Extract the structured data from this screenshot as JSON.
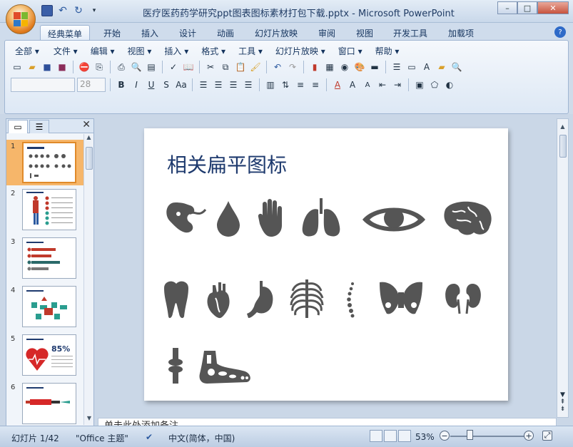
{
  "window": {
    "title": "医疗医药药学研究ppt图表图标素材打包下载.pptx - Microsoft PowerPoint",
    "controls": {
      "minimize": "–",
      "maximize": "□",
      "close": "✕"
    }
  },
  "ribbon_tabs": [
    "经典菜单",
    "开始",
    "插入",
    "设计",
    "动画",
    "幻灯片放映",
    "审阅",
    "视图",
    "开发工具",
    "加载项"
  ],
  "active_tab": "经典菜单",
  "classic_menu": [
    "全部 ▾",
    "文件 ▾",
    "编辑 ▾",
    "视图 ▾",
    "插入 ▾",
    "格式 ▾",
    "工具 ▾",
    "幻灯片放映 ▾",
    "窗口 ▾",
    "帮助 ▾"
  ],
  "format_bar": {
    "font_name": "",
    "font_size": "28",
    "bold": "B",
    "italic": "I",
    "underline": "U",
    "strike": "S",
    "case": "Aa"
  },
  "panel": {
    "close": "✕",
    "slides": [
      {
        "num": "1",
        "selected": true
      },
      {
        "num": "2",
        "selected": false
      },
      {
        "num": "3",
        "selected": false
      },
      {
        "num": "4",
        "selected": false
      },
      {
        "num": "5",
        "selected": false
      },
      {
        "num": "6",
        "selected": false
      }
    ],
    "slide5_percent": "85%"
  },
  "slide": {
    "title": "相关扁平图标",
    "icons": [
      "kidney-embryo-icon",
      "drop-icon",
      "hand-icon",
      "lungs-icon",
      "eye-icon",
      "brain-icon",
      "tooth-icon",
      "heart-icon",
      "stomach-icon",
      "ribcage-icon",
      "spine-icon",
      "pelvis-icon",
      "kidneys-icon",
      "knee-joint-icon",
      "foot-icon"
    ],
    "icon_color": "#555555"
  },
  "notes_placeholder": "单击此处添加备注",
  "status": {
    "slide_info": "幻灯片 1/42",
    "theme": "\"Office 主题\"",
    "language": "中文(简体，中国)",
    "zoom": "53%"
  },
  "colors": {
    "title": "#1e3a6e",
    "selected_thumb": "#f6b66a"
  }
}
